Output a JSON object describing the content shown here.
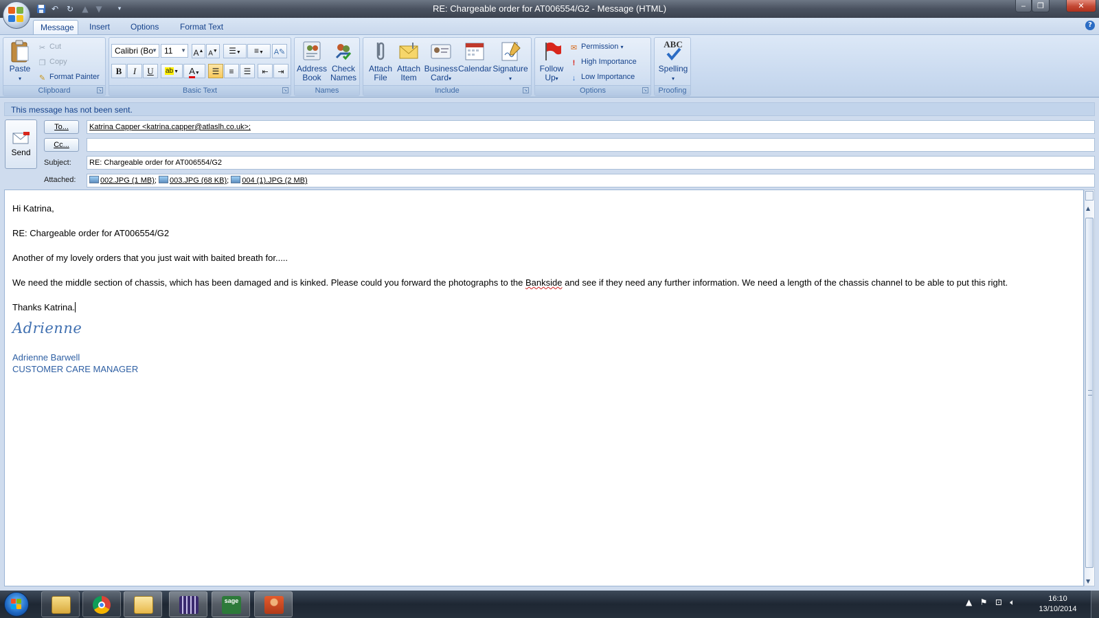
{
  "window": {
    "title": "RE: Chargeable order for AT006554/G2 - Message (HTML)"
  },
  "ribbon": {
    "tabs": [
      "Message",
      "Insert",
      "Options",
      "Format Text"
    ],
    "clipboard": {
      "label": "Clipboard",
      "paste": "Paste",
      "cut": "Cut",
      "copy": "Copy",
      "format_painter": "Format Painter"
    },
    "basic_text": {
      "label": "Basic Text",
      "font": "Calibri (Bo",
      "size": "11"
    },
    "names": {
      "label": "Names",
      "address_book": [
        "Address",
        "Book"
      ],
      "check_names": [
        "Check",
        "Names"
      ]
    },
    "include": {
      "label": "Include",
      "attach_file": [
        "Attach",
        "File"
      ],
      "attach_item": [
        "Attach",
        "Item"
      ],
      "business_card": [
        "Business",
        "Card"
      ],
      "calendar": "Calendar",
      "signature": "Signature"
    },
    "options": {
      "label": "Options",
      "follow_up": [
        "Follow",
        "Up"
      ],
      "permission": "Permission",
      "high_importance": "High Importance",
      "low_importance": "Low Importance"
    },
    "proofing": {
      "label": "Proofing",
      "spelling": "Spelling",
      "icon_text": "ABC"
    }
  },
  "infobar": "This message has not been sent.",
  "header": {
    "send": "Send",
    "to_button": "To...",
    "cc_button": "Cc...",
    "subject_label": "Subject:",
    "attached_label": "Attached:",
    "to_value": "Katrina Capper <katrina.capper@atlaslh.co.uk>;",
    "cc_value": "",
    "subject_value": "RE: Chargeable order for AT006554/G2",
    "attachments": [
      "002.JPG (1 MB)",
      "003.JPG (68 KB)",
      "004 (1).JPG (2 MB)"
    ]
  },
  "body": {
    "greeting": "Hi Katrina,",
    "subject_line": "RE: Chargeable order for AT006554/G2",
    "line1": "Another of my lovely orders that you just wait with baited breath for.....",
    "line2_a": "We need the middle section of chassis, which has been damaged and is kinked.  Please could you forward the photographs to the ",
    "line2_misspelled": "Bankside",
    "line2_b": " and see if they need any further information.  We need a length of the chassis channel to be able to put this right.",
    "thanks": "Thanks Katrina.",
    "signature_script": "Adrienne",
    "signature_name": "Adrienne Barwell",
    "signature_title": "CUSTOMER CARE MANAGER"
  },
  "taskbar": {
    "time": "16:10",
    "date": "13/10/2014",
    "apps": [
      "windows-explorer",
      "google-chrome",
      "outlook",
      "calendar-app",
      "sage",
      "contacts-app"
    ]
  },
  "colors": {
    "ribbon_text": "#15428b",
    "signature": "#2e5fa3",
    "close_button": "#c24732"
  }
}
